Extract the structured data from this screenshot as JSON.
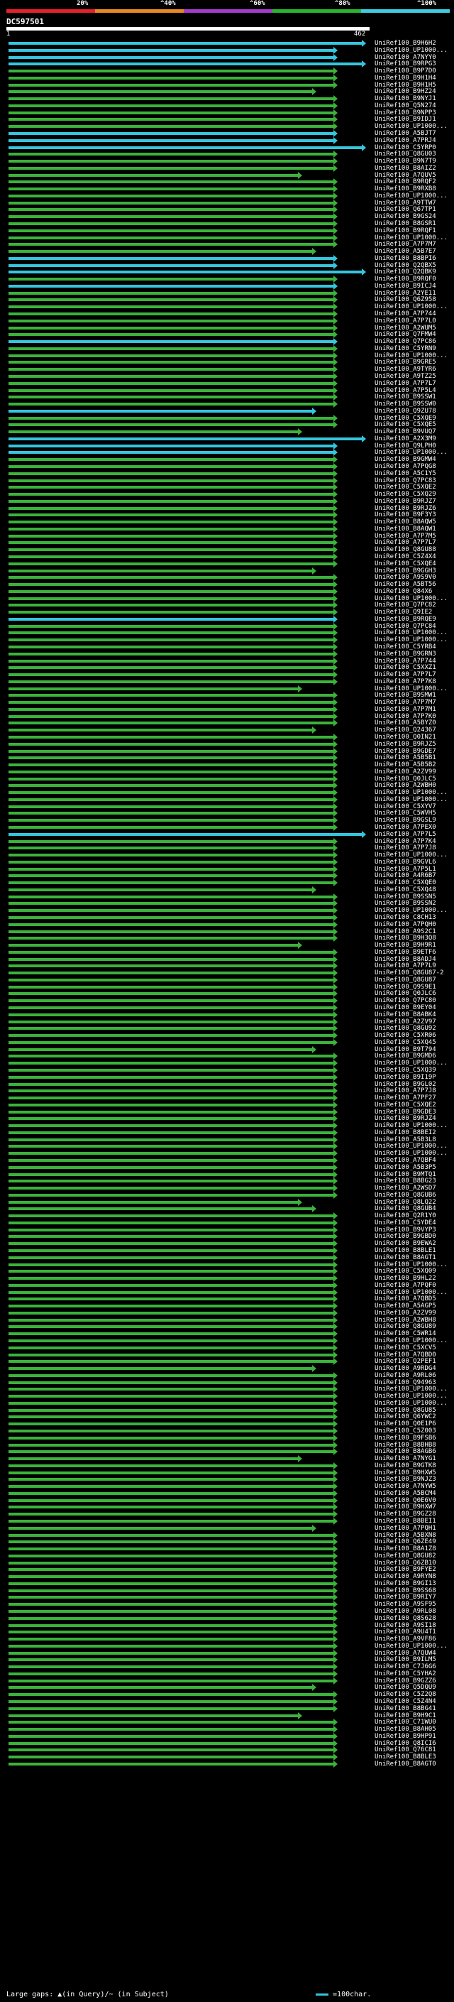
{
  "scale": {
    "labels": [
      "20%",
      "^40%",
      "^60%",
      "^80%",
      "^100%"
    ],
    "colors": [
      "#e8202a",
      "#e88a22",
      "#a63ccc",
      "#2ab52f",
      "#3ecde0"
    ]
  },
  "query": {
    "id": "DC597501",
    "start": "1",
    "end": "462"
  },
  "hits": [
    "UniRef100_B9H6H2",
    "UniRef100_UP1000...",
    "UniRef100_A7NYY0",
    "UniRef100_B9RPG3",
    "UniRef100_B9P7D0",
    "UniRef100_B9H1H4",
    "UniRef100_B9H1H5",
    "UniRef100_B9HZ24",
    "UniRef100_B9NYJ1",
    "UniRef100_Q5N274",
    "UniRef100_B9NPP3",
    "UniRef100_B9IDJ1",
    "UniRef100_UP1000...",
    "UniRef100_A5BJT7",
    "UniRef100_A7PRJ4",
    "UniRef100_C5YRP0",
    "UniRef100_Q8GU03",
    "UniRef100_B9N7T9",
    "UniRef100_B8AIZ2",
    "UniRef100_A7QUV5",
    "UniRef100_B9RQF2",
    "UniRef100_B9RXB8",
    "UniRef100_UP1000...",
    "UniRef100_A9TTW7",
    "UniRef100_Q67TP1",
    "UniRef100_B9GS24",
    "UniRef100_B8GSR1",
    "UniRef100_B9RQF1",
    "UniRef100_UP1000...",
    "UniRef100_A7P7M7",
    "UniRef100_A5B7E7",
    "UniRef100_B8BPI6",
    "UniRef100_Q2QBX5",
    "UniRef100_Q2QBK9",
    "UniRef100_B9RQF0",
    "UniRef100_B9ICJ4",
    "UniRef100_A2YE11",
    "UniRef100_Q6Z958",
    "UniRef100_UP1000...",
    "UniRef100_A7P744",
    "UniRef100_A7P7L0",
    "UniRef100_A2WUM5",
    "UniRef100_Q7FMW4",
    "UniRef100_Q7PC86",
    "UniRef100_C5YRN9",
    "UniRef100_UP1000...",
    "UniRef100_B9GRE5",
    "UniRef100_A9TYR6",
    "UniRef100_A9TZ25",
    "UniRef100_A7P7L7",
    "UniRef100_A7P5L4",
    "UniRef100_B9SSW1",
    "UniRef100_B9SSW0",
    "UniRef100_Q9ZU78",
    "UniRef100_C5XQE9",
    "UniRef100_C5XQE5",
    "UniRef100_B9VUQ7",
    "UniRef100_A2X3M9",
    "UniRef100_Q9LPH0",
    "UniRef100_UP1000...",
    "UniRef100_B9GMW4",
    "UniRef100_A7PQG8",
    "UniRef100_A5C1Y5",
    "UniRef100_Q7PC83",
    "UniRef100_C5XQE2",
    "UniRef100_C5XQ29",
    "UniRef100_B9RJZ7",
    "UniRef100_B9RJZ6",
    "UniRef100_B9F3Y3",
    "UniRef100_B8AQW5",
    "UniRef100_B8AQW1",
    "UniRef100_A7P7M5",
    "UniRef100_A7P7L7",
    "UniRef100_Q8GU88",
    "UniRef100_C5Z4X4",
    "UniRef100_C5XQE4",
    "UniRef100_B9GGH3",
    "UniRef100_A9S9V0",
    "UniRef100_A5BT56",
    "UniRef100_Q84X6",
    "UniRef100_UP1000...",
    "UniRef100_Q7PC82",
    "UniRef100_Q9IE2",
    "UniRef100_B9RQE9",
    "UniRef100_Q7PC84",
    "UniRef100_UP1000...",
    "UniRef100_UP1000...",
    "UniRef100_C5YRB4",
    "UniRef100_B9GRN3",
    "UniRef100_A7P744",
    "UniRef100_C5XXZ1",
    "UniRef100_A7P7L7",
    "UniRef100_A7P7K8",
    "UniRef100_UP1000...",
    "UniRef100_B9SMW1",
    "UniRef100_A7P7M7",
    "UniRef100_A7P7M1",
    "UniRef100_A7P7K0",
    "UniRef100_A5BYZ0",
    "UniRef100_Q24367",
    "UniRef100_Q0IN21",
    "UniRef100_B9RJZ5",
    "UniRef100_B9GDE7",
    "UniRef100_A5B5B1",
    "UniRef100_A5B5B2",
    "UniRef100_A2ZV99",
    "UniRef100_Q0JLC5",
    "UniRef100_A2WBH0",
    "UniRef100_UP1000...",
    "UniRef100_UP1000...",
    "UniRef100_C5XYV7",
    "UniRef100_C5WVH5",
    "UniRef100_B9GSL9",
    "UniRef100_A7PEX0",
    "UniRef100_A7P7L5",
    "UniRef100_A7P7K4",
    "UniRef100_A7P7J8",
    "UniRef100_UP1000...",
    "UniRef100_B9GVL6",
    "UniRef100_A7P5L1",
    "UniRef100_A4R6B7",
    "UniRef100_C5XQE0",
    "UniRef100_C5XQ48",
    "UniRef100_B9SSN5",
    "UniRef100_B9SSN2",
    "UniRef100_UP1000...",
    "UniRef100_C8CH13",
    "UniRef100_A7PQH0",
    "UniRef100_A9S2C1",
    "UniRef100_B9H3Q8",
    "UniRef100_B9H9R1",
    "UniRef100_B9ETF6",
    "UniRef100_B8ADJ4",
    "UniRef100_A7P7L9",
    "UniRef100_Q8GU87-2",
    "UniRef100_Q8GU87",
    "UniRef100_Q9S9E1",
    "UniRef100_Q0JLC6",
    "UniRef100_Q7PC80",
    "UniRef100_B9EY04",
    "UniRef100_B8ABK4",
    "UniRef100_A2ZV97",
    "UniRef100_Q8GU92",
    "UniRef100_C5XR06",
    "UniRef100_C5XQ45",
    "UniRef100_B9T794",
    "UniRef100_B9GMD6",
    "UniRef100_UP1000...",
    "UniRef100_C5XQ39",
    "UniRef100_B9I19P",
    "UniRef100_B9GL02",
    "UniRef100_A7P7J8",
    "UniRef100_A7PF27",
    "UniRef100_C5XQE2",
    "UniRef100_B9GDE3",
    "UniRef100_B9RJZ4",
    "UniRef100_UP1000...",
    "UniRef100_B8BEI2",
    "UniRef100_A5B3L8",
    "UniRef100_UP1000...",
    "UniRef100_UP1000...",
    "UniRef100_A7QBF4",
    "UniRef100_A5B3P5",
    "UniRef100_B9MTQ1",
    "UniRef100_B8BG23",
    "UniRef100_A2WSD7",
    "UniRef100_Q8GUB6",
    "UniRef100_Q8LQ22",
    "UniRef100_Q8GUB4",
    "UniRef100_Q2R1Y0",
    "UniRef100_C5YDE4",
    "UniRef100_B9VYP3",
    "UniRef100_B9GBD0",
    "UniRef100_B9EWA2",
    "UniRef100_B8BLE1",
    "UniRef100_B8AGT1",
    "UniRef100_UP1000...",
    "UniRef100_C5XQ09",
    "UniRef100_B9HL22",
    "UniRef100_A7PQF0",
    "UniRef100_UP1000...",
    "UniRef100_A7QBD5",
    "UniRef100_A5AGP5",
    "UniRef100_A2ZV99",
    "UniRef100_A2WBH8",
    "UniRef100_Q8GU89",
    "UniRef100_C5WR14",
    "UniRef100_UP1000...",
    "UniRef100_C5XCV5",
    "UniRef100_A7QBD0",
    "UniRef100_Q2PEF1",
    "UniRef100_A9RDG4",
    "UniRef100_A9RL06",
    "UniRef100_Q94963",
    "UniRef100_UP1000...",
    "UniRef100_UP1000...",
    "UniRef100_UP1000...",
    "UniRef100_Q8GU85",
    "UniRef100_Q6YWC2",
    "UniRef100_Q0E1P6",
    "UniRef100_C5Z003",
    "UniRef100_B9FSB6",
    "UniRef100_B8BHB8",
    "UniRef100_B8AGB6",
    "UniRef100_A7NYG1",
    "UniRef100_B9GTK8",
    "UniRef100_B9HXW5",
    "UniRef100_B9NJZ3",
    "UniRef100_A7NYW5",
    "UniRef100_A5BCM4",
    "UniRef100_Q0E6V0",
    "UniRef100_B9HXW7",
    "UniRef100_B9GZ28",
    "UniRef100_B8BEI1",
    "UniRef100_A7PQH1",
    "UniRef100_A5BXN8",
    "UniRef100_Q6ZE49",
    "UniRef100_B8A1Z8",
    "UniRef100_Q8GU82",
    "UniRef100_Q6ZB10",
    "UniRef100_B9FYE2",
    "UniRef100_A9RYN8",
    "UniRef100_B9GI13",
    "UniRef100_B9SS68",
    "UniRef100_B9RIY7",
    "UniRef100_A9SF95",
    "UniRef100_A9RL08",
    "UniRef100_Q8S628",
    "UniRef100_A9SI18",
    "UniRef100_A9U4T1",
    "UniRef100_A9VF86",
    "UniRef100_UP1000...",
    "UniRef100_A7QUW4",
    "UniRef100_B9ILM5",
    "UniRef100_C7J6G6",
    "UniRef100_C5YHA2",
    "UniRef100_B9GZZ6",
    "UniRef100_Q5DQU9",
    "UniRef100_C5Z2Q8",
    "UniRef100_C5Z4N4",
    "UniRef100_B8BG41",
    "UniRef100_B9H9C1",
    "UniRef100_C71WU0",
    "UniRef100_B8AH05",
    "UniRef100_B9HP91",
    "UniRef100_Q8ICI6",
    "UniRef100_Q76C81",
    "UniRef100_B8BLE3",
    "UniRef100_B8AGT0"
  ],
  "footer": {
    "gaps_label": "Large gaps: ▲(in Query)/~ (in Subject)",
    "legend_label": "=100char."
  }
}
